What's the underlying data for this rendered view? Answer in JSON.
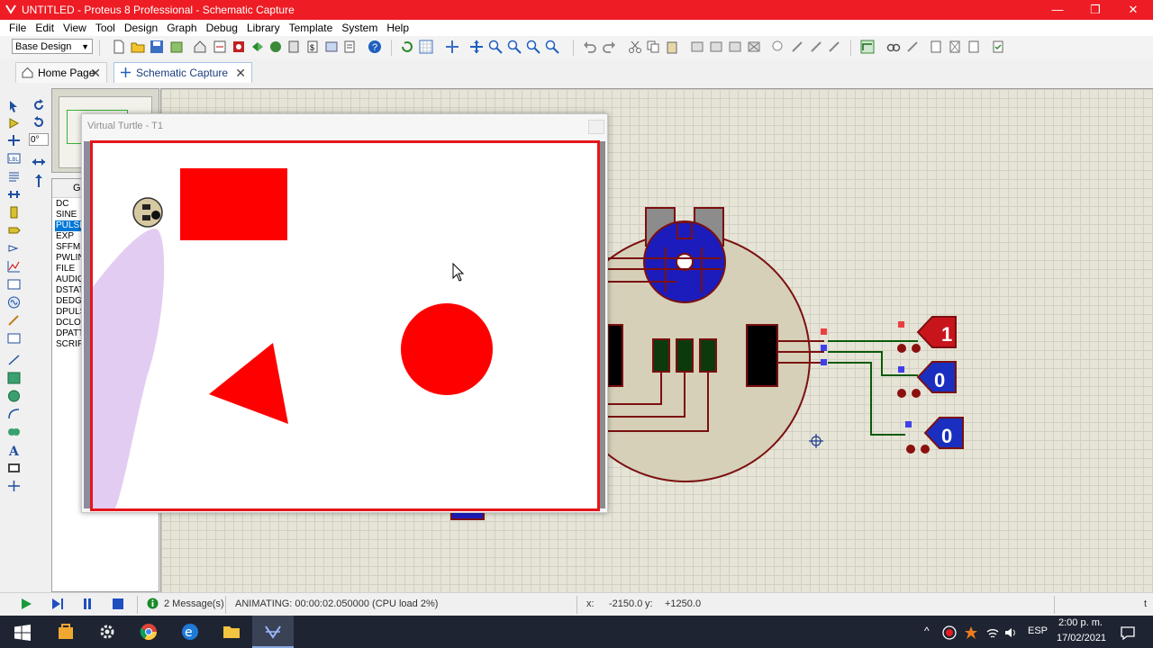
{
  "window": {
    "title": "UNTITLED - Proteus 8 Professional - Schematic Capture",
    "minimize": "—",
    "maximize": "❐",
    "close": "✕"
  },
  "menu": [
    "File",
    "Edit",
    "View",
    "Tool",
    "Design",
    "Graph",
    "Debug",
    "Library",
    "Template",
    "System",
    "Help"
  ],
  "toolbar": {
    "design_select": "Base Design"
  },
  "tabs": [
    {
      "label": "Home Page",
      "close": "✕"
    },
    {
      "label": "Schematic Capture",
      "close": "✕"
    }
  ],
  "rotation": {
    "angle": "0°"
  },
  "device_panel": {
    "header": "G",
    "generators": [
      "DC",
      "SINE",
      "PULSE",
      "EXP",
      "SFFM",
      "PWLIN",
      "FILE",
      "AUDIO",
      "DSTATE",
      "DEDGE",
      "DPULSE",
      "DCLOCK",
      "DPATTERN",
      "SCRIPT"
    ],
    "selected": "PULSE"
  },
  "virtual_turtle": {
    "title": "Virtual Turtle - T1"
  },
  "probes": [
    {
      "value": "1",
      "color": "#c8141b"
    },
    {
      "value": "0",
      "color": "#1a2fbf"
    },
    {
      "value": "0",
      "color": "#1a2fbf"
    }
  ],
  "status": {
    "messages": "2 Message(s)",
    "animating": "ANIMATING: 00:00:02.050000 (CPU load 2%)",
    "x_label": "x:",
    "x_value": "-2150.0",
    "y_label": "y:",
    "y_value": "+1250.0",
    "trail": "t"
  },
  "taskbar": {
    "language": "ESP",
    "time": "2:00 p. m.",
    "date": "17/02/2021"
  },
  "colors": {
    "title_bar": "#ee1c24",
    "arena_border": "#e5151b",
    "shape_fill": "#ff0000",
    "trail": "#e3ccf2",
    "robot_body": "#d6d0b8",
    "motor_blue": "#1c1cbd"
  }
}
